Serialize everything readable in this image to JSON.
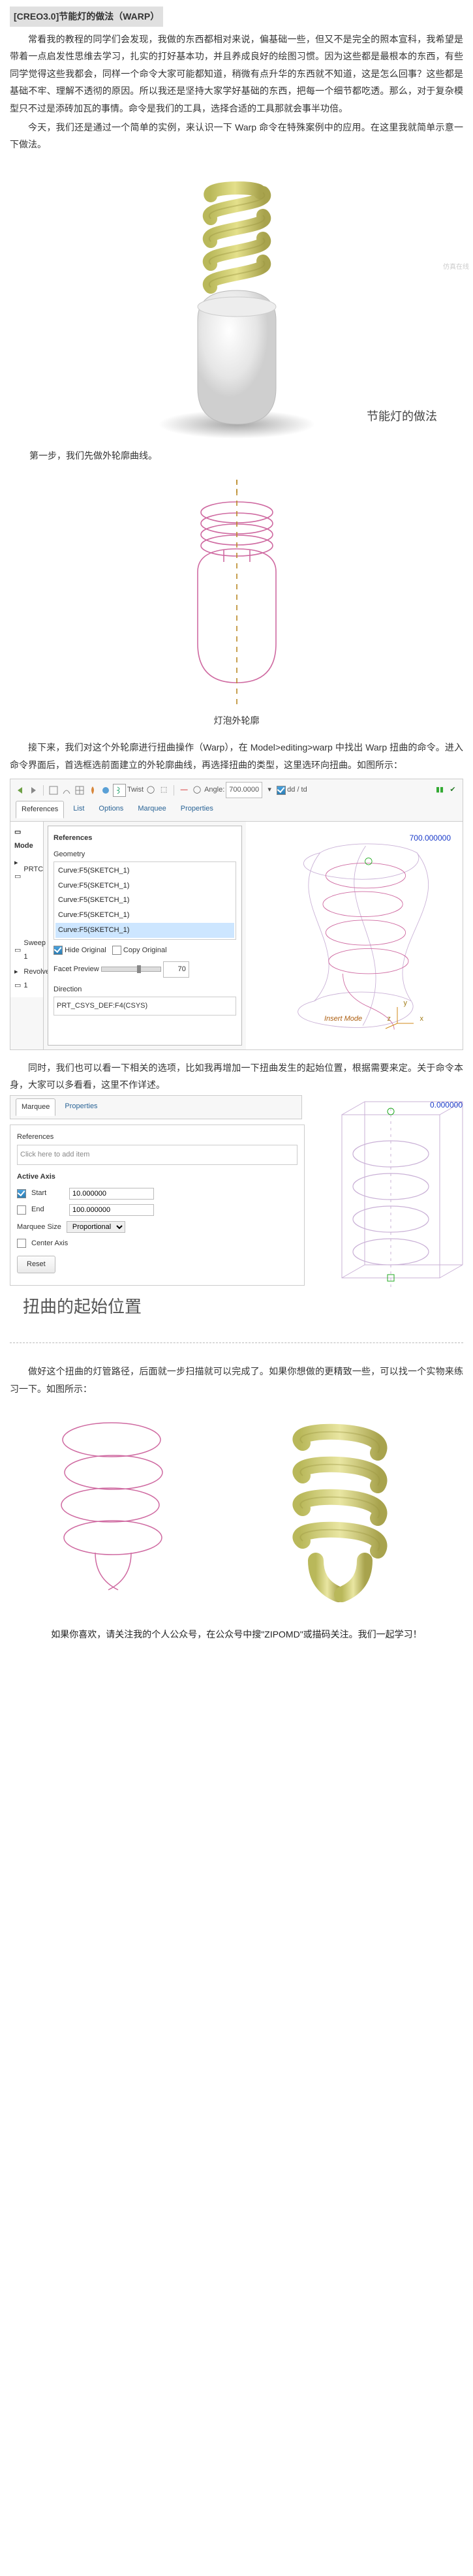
{
  "title": "[CREO3.0]节能灯的做法（WARP）",
  "para1": "常看我的教程的同学们会发现，我做的东西都相对来说，偏基础一些，但又不是完全的照本宣科，我希望是带着一点启发性思维去学习，扎实的打好基本功，并且养成良好的绘图习惯。因为这些都是最根本的东西，有些同学觉得这些我都会，同样一个命令大家可能都知道，稍微有点升华的东西就不知道，这是怎么回事？这些都是基础不牢、理解不透彻的原因。所以我还是坚持大家学好基础的东西，把每一个细节都吃透。那么，对于复杂模型只不过是添砖加瓦的事情。命令是我们的工具，选择合适的工具那就会事半功倍。",
  "para2": "今天，我们还是通过一个简单的实例，来认识一下 Warp 命令在特殊案例中的应用。在这里我就简单示意一下做法。",
  "fig1_caption_right": "节能灯的做法",
  "fig1_caption_under": "第一步，我们先做外轮廓曲线。",
  "fig2_caption_center": "灯泡外轮廓",
  "para3": "接下来，我们对这个外轮廓进行扭曲操作（Warp），在 Model>editing>warp 中找出 Warp 扭曲的命令。进入命令界面后，首选框选前面建立的外轮廓曲线，再选择扭曲的类型，这里选环向扭曲。如图所示：",
  "shot1": {
    "toolbar": {
      "twist_label": "Twist",
      "angle_label": "Angle:",
      "angle_value": "700.0000",
      "ddtd_label": "dd / td"
    },
    "subtabs": [
      "References",
      "List",
      "Options",
      "Marquee",
      "Properties"
    ],
    "panel_title": "References",
    "geometry_label": "Geometry",
    "ref_rows": [
      "Curve:F5(SKETCH_1)",
      "Curve:F5(SKETCH_1)",
      "Curve:F5(SKETCH_1)",
      "Curve:F5(SKETCH_1)",
      "Curve:F5(SKETCH_1)"
    ],
    "hide_original": "Hide Original",
    "copy_original": "Copy Original",
    "facet_preview": "Facet Preview",
    "facet_value": "70",
    "direction_label": "Direction",
    "direction_value": "PRT_CSYS_DEF:F4(CSYS)",
    "tree_items": [
      "PRTC",
      "Sweep 1",
      "Revolve 1"
    ],
    "tree_title": "Mode",
    "insert": "Insert Mode",
    "dim_value": "700.000000",
    "axis_x": "x",
    "axis_y": "y",
    "axis_z": "z"
  },
  "para4": "同时，我们也可以看一下相关的选项，比如我再增加一下扭曲发生的起始位置，根据需要来定。关于命令本身，大家可以多看看，这里不作详述。",
  "shot2": {
    "subtabs": [
      "Marquee",
      "Properties"
    ],
    "panel_title": "References",
    "click_hint": "Click here to add item",
    "active_axis": "Active Axis",
    "start_label": "Start",
    "start_value": "10.000000",
    "end_label": "End",
    "end_value": "100.000000",
    "marquee_size": "Marquee Size",
    "marquee_value": "Proportional",
    "center_axis": "Center Axis",
    "reset_btn": "Reset",
    "dim_value": "0.000000"
  },
  "big_label": "扭曲的起始位置",
  "para5": "做好这个扭曲的灯管路径，后面就一步扫描就可以完成了。如果你想做的更精致一些，可以找一个实物来练习一下。如图所示：",
  "footer": "如果你喜欢，请关注我的个人公众号，在公众号中搜\"ZIPOMD\"或描码关注。我们一起学习！",
  "watermark": "仿真在线"
}
